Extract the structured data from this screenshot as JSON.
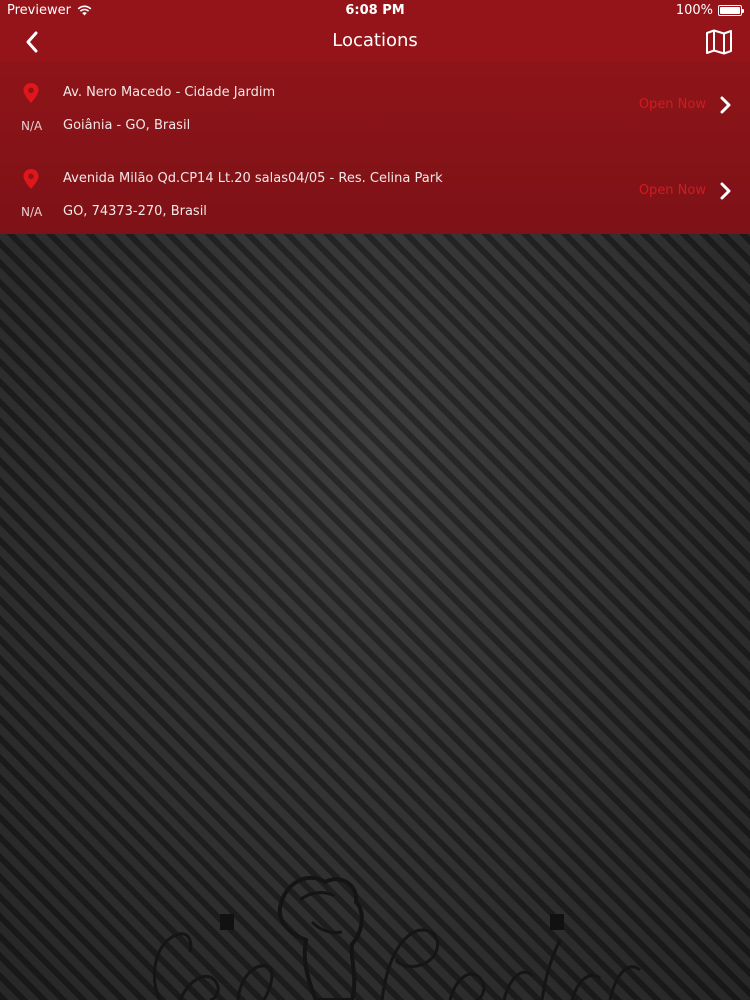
{
  "status_bar": {
    "carrier": "Previewer",
    "time": "6:08 PM",
    "battery": "100%"
  },
  "nav": {
    "title": "Locations",
    "back_icon": "chevron-left-icon",
    "map_icon": "map-icon"
  },
  "locations": [
    {
      "distance": "N/A",
      "address_line1": "Av. Nero Macedo - Cidade Jardim",
      "address_line2": "Goiânia - GO, Brasil",
      "status": "Open Now"
    },
    {
      "distance": "N/A",
      "address_line1": "Avenida Milão Qd.CP14 Lt.20 salas04/05 - Res. Celina Park",
      "address_line2": "GO, 74373-270, Brasil",
      "status": "Open Now"
    }
  ],
  "colors": {
    "brand": "#94141a",
    "status_text": "#d41a1f",
    "pin": "#e0161c"
  }
}
